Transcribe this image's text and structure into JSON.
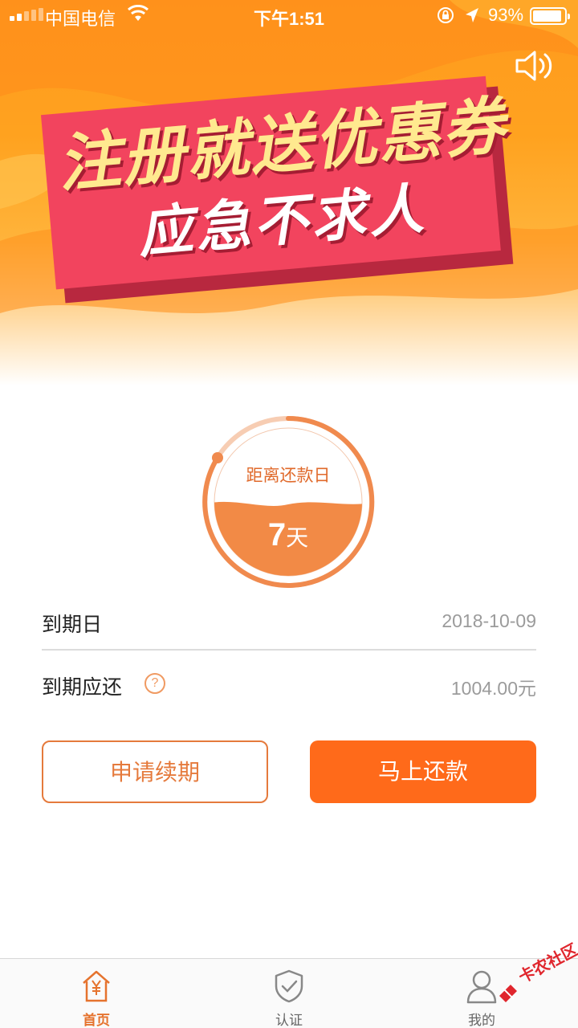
{
  "status_bar": {
    "carrier": "中国电信",
    "time": "下午1:51",
    "battery_percent": "93%",
    "battery_level": 0.93
  },
  "banner": {
    "title": "注册就送优惠券",
    "subtitle": "应急不求人",
    "speaker_icon": "speaker-icon"
  },
  "countdown": {
    "label": "距离还款日",
    "value": "7",
    "unit": "天"
  },
  "info": {
    "due_date_label": "到期日",
    "due_date_value": "2018-10-09",
    "amount_label": "到期应还",
    "help_symbol": "?",
    "amount_value": "1004.00元"
  },
  "actions": {
    "renew_label": "申请续期",
    "repay_label": "马上还款"
  },
  "tabbar": {
    "home": "首页",
    "auth": "认证",
    "mine": "我的"
  },
  "watermark": {
    "text": "卡农社区"
  },
  "colors": {
    "accent": "#ff6a1a",
    "accent_outline": "#e57a3c",
    "banner_orange": "#ff9a1e",
    "promo_pink": "#f2445e",
    "promo_yellow": "#ffe98f"
  }
}
